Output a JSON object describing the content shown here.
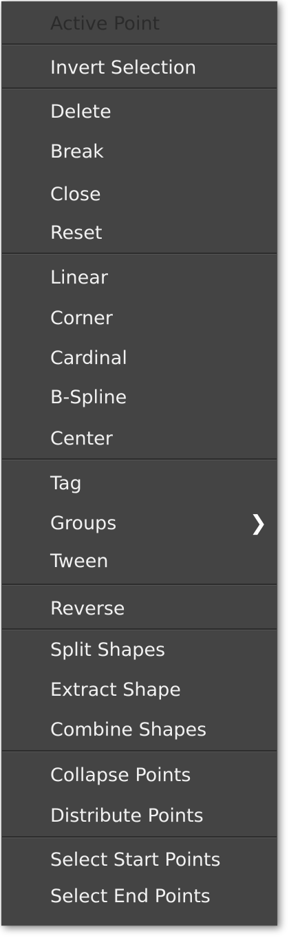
{
  "menu": {
    "items": [
      {
        "label": "Active Point"
      },
      {
        "label": "Invert Selection"
      },
      {
        "label": "Delete"
      },
      {
        "label": "Break"
      },
      {
        "label": "Close"
      },
      {
        "label": "Reset"
      },
      {
        "label": "Linear"
      },
      {
        "label": "Corner"
      },
      {
        "label": "Cardinal"
      },
      {
        "label": "B-Spline"
      },
      {
        "label": "Center"
      },
      {
        "label": "Tag"
      },
      {
        "label": "Groups",
        "submenu": true
      },
      {
        "label": "Tween"
      },
      {
        "label": "Reverse"
      },
      {
        "label": "Split Shapes"
      },
      {
        "label": "Extract Shape"
      },
      {
        "label": "Combine Shapes"
      },
      {
        "label": "Collapse Points"
      },
      {
        "label": "Distribute Points"
      },
      {
        "label": "Select Start Points"
      },
      {
        "label": "Select End Points"
      }
    ],
    "submenu_arrow": "❯"
  }
}
